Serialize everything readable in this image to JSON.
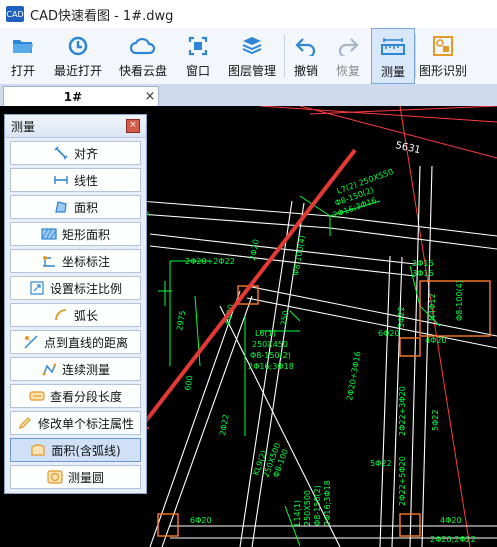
{
  "window": {
    "title": "CAD快速看图 - 1#.dwg",
    "logo_text": "CAD"
  },
  "toolbar": {
    "items": [
      {
        "label": "打开",
        "icon": "folder-open-icon"
      },
      {
        "label": "最近打开",
        "icon": "recent-clock-icon"
      },
      {
        "label": "快看云盘",
        "icon": "cloud-icon"
      },
      {
        "label": "窗口",
        "icon": "window-icon"
      },
      {
        "label": "图层管理",
        "icon": "layers-icon"
      },
      {
        "label": "撤销",
        "icon": "undo-icon"
      },
      {
        "label": "恢复",
        "icon": "redo-icon"
      },
      {
        "label": "测量",
        "icon": "measure-ruler-icon"
      },
      {
        "label": "图形识别",
        "icon": "shape-recognize-icon"
      }
    ]
  },
  "tab": {
    "label": "1#",
    "close": "×"
  },
  "panel": {
    "title": "测量",
    "close": "×",
    "items": [
      {
        "label": "对齐"
      },
      {
        "label": "线性"
      },
      {
        "label": "面积"
      },
      {
        "label": "矩形面积"
      },
      {
        "label": "坐标标注"
      },
      {
        "label": "设置标注比例"
      },
      {
        "label": "弧长"
      },
      {
        "label": "点到直线的距离"
      },
      {
        "label": "连续测量"
      },
      {
        "label": "查看分段长度"
      },
      {
        "label": "修改单个标注属性"
      },
      {
        "label": "面积(含弧线)"
      },
      {
        "label": "测量圆"
      }
    ]
  },
  "drawing": {
    "labels": [
      "5631",
      "L7(2) 250X550",
      "Φ8-150(2)",
      "2Φ16;3Φ16",
      "3Φ16",
      "2Φ20+2Φ22",
      "2Φ20",
      "Φ8-100(4)",
      "3Φ16",
      "4Φ20",
      "N4Φ12",
      "Φ8-100(4)",
      "L6(1)",
      "250X450",
      "Φ8-150(2)",
      "2Φ16;3Φ18",
      "2Φ20+3Φ16",
      "5Φ22",
      "6Φ20",
      "2975",
      "600",
      "250",
      "4Φ20",
      "2Φ22+3Φ20",
      "5Φ22",
      "KL9(2)",
      "250X500",
      "Φ8-100",
      "2Φ22",
      "L14(1)",
      "250X500",
      "Φ8-150(2)",
      "2Φ16;3Φ18",
      "5Φ22",
      "2Φ22+5Φ20",
      "4Φ20",
      "6Φ20",
      "2Φ20;2Φ22"
    ],
    "colors": {
      "axis_red": "#ff3b3b",
      "beam_white": "#ffffff",
      "dim_green": "#00ff3c",
      "column_orange": "#ff7a2a",
      "arrow_red": "#e53935"
    }
  }
}
